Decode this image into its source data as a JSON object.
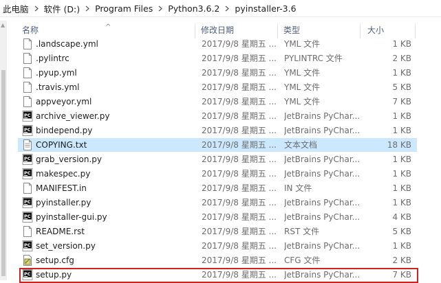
{
  "breadcrumb": [
    "此电脑",
    "软件 (D:)",
    "Program Files",
    "Python3.6.2",
    "pyinstaller-3.6"
  ],
  "columns": {
    "name": "名称",
    "date": "修改日期",
    "type": "类型",
    "size": "大小"
  },
  "files": [
    {
      "name": ".landscape.yml",
      "date": "2017/9/8 星期五 ...",
      "type": "YML 文件",
      "size": "1 KB",
      "icon": "generic-file-icon"
    },
    {
      "name": ".pylintrc",
      "date": "2017/9/8 星期五 ...",
      "type": "PYLINTRC 文件",
      "size": "2 KB",
      "icon": "generic-file-icon"
    },
    {
      "name": ".pyup.yml",
      "date": "2017/9/8 星期五 ...",
      "type": "YML 文件",
      "size": "1 KB",
      "icon": "generic-file-icon"
    },
    {
      "name": ".travis.yml",
      "date": "2017/9/8 星期五 ...",
      "type": "YML 文件",
      "size": "5 KB",
      "icon": "generic-file-icon"
    },
    {
      "name": "appveyor.yml",
      "date": "2017/9/8 星期五 ...",
      "type": "YML 文件",
      "size": "7 KB",
      "icon": "generic-file-icon"
    },
    {
      "name": "archive_viewer.py",
      "date": "2017/9/8 星期五 ...",
      "type": "JetBrains PyChar...",
      "size": "1 KB",
      "icon": "pycharm-file-icon"
    },
    {
      "name": "bindepend.py",
      "date": "2017/9/8 星期五 ...",
      "type": "JetBrains PyChar...",
      "size": "1 KB",
      "icon": "pycharm-file-icon"
    },
    {
      "name": "COPYING.txt",
      "date": "2017/9/8 星期五 ...",
      "type": "文本文档",
      "size": "18 KB",
      "icon": "text-file-icon",
      "selected": true
    },
    {
      "name": "grab_version.py",
      "date": "2017/9/8 星期五 ...",
      "type": "JetBrains PyChar...",
      "size": "1 KB",
      "icon": "pycharm-file-icon"
    },
    {
      "name": "makespec.py",
      "date": "2017/9/8 星期五 ...",
      "type": "JetBrains PyChar...",
      "size": "1 KB",
      "icon": "pycharm-file-icon"
    },
    {
      "name": "MANIFEST.in",
      "date": "2017/9/8 星期五 ...",
      "type": "IN 文件",
      "size": "1 KB",
      "icon": "generic-file-icon"
    },
    {
      "name": "pyinstaller.py",
      "date": "2017/9/8 星期五 ...",
      "type": "JetBrains PyChar...",
      "size": "1 KB",
      "icon": "pycharm-file-icon"
    },
    {
      "name": "pyinstaller-gui.py",
      "date": "2017/9/8 星期五 ...",
      "type": "JetBrains PyChar...",
      "size": "4 KB",
      "icon": "pycharm-file-icon"
    },
    {
      "name": "README.rst",
      "date": "2017/9/8 星期五 ...",
      "type": "RST 文件",
      "size": "5 KB",
      "icon": "generic-file-icon"
    },
    {
      "name": "set_version.py",
      "date": "2017/9/8 星期五 ...",
      "type": "JetBrains PyChar...",
      "size": "1 KB",
      "icon": "pycharm-file-icon"
    },
    {
      "name": "setup.cfg",
      "date": "2017/9/8 星期五 ...",
      "type": "CFG 文件",
      "size": "2 KB",
      "icon": "config-file-icon"
    },
    {
      "name": "setup.py",
      "date": "2017/9/8 星期五 ...",
      "type": "JetBrains PyChar...",
      "size": "7 KB",
      "icon": "pycharm-file-icon",
      "highlighted": true
    }
  ],
  "colors": {
    "selection": "#cce8ff",
    "highlight_border": "#d02020",
    "header_text": "#4d6082"
  }
}
